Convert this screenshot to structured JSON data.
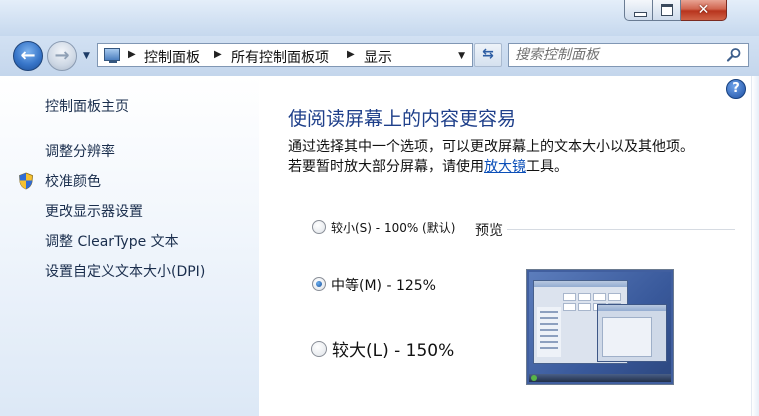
{
  "window": {
    "min_glyph": "min-glyph",
    "max_glyph": "max-glyph",
    "close_glyph": "✕"
  },
  "nav": {
    "back_arrow": "←",
    "forward_arrow": "→",
    "recent_dropdown": "▼",
    "breadcrumb": [
      "控制面板",
      "所有控制面板项",
      "显示"
    ],
    "address_dropdown": "▼",
    "refresh_glyph": "⇆",
    "search_placeholder": "搜索控制面板"
  },
  "sidebar": {
    "items": [
      {
        "label": "控制面板主页"
      },
      {
        "label": "调整分辨率"
      },
      {
        "label": "校准颜色",
        "icon": "shield-icon"
      },
      {
        "label": "更改显示器设置"
      },
      {
        "label": "调整 ClearType 文本"
      },
      {
        "label": "设置自定义文本大小(DPI)"
      }
    ]
  },
  "main": {
    "help": "?",
    "heading": "使阅读屏幕上的内容更容易",
    "desc_line1": "通过选择其中一个选项，可以更改屏幕上的文本大小以及其他项。",
    "desc_line2_prefix": "若要暂时放大部分屏幕，请使用",
    "desc_link": "放大镜",
    "desc_line2_suffix": "工具。",
    "options": [
      {
        "label": "较小(S) - 100% (默认)",
        "checked": false
      },
      {
        "label": "中等(M) - 125%",
        "checked": true
      },
      {
        "label": "较大(L) - 150%",
        "checked": false
      }
    ],
    "preview_label": "预览"
  },
  "colors": {
    "heading": "#1e3f8a",
    "link": "#0b4fb8",
    "close_button": "#c2452c"
  }
}
